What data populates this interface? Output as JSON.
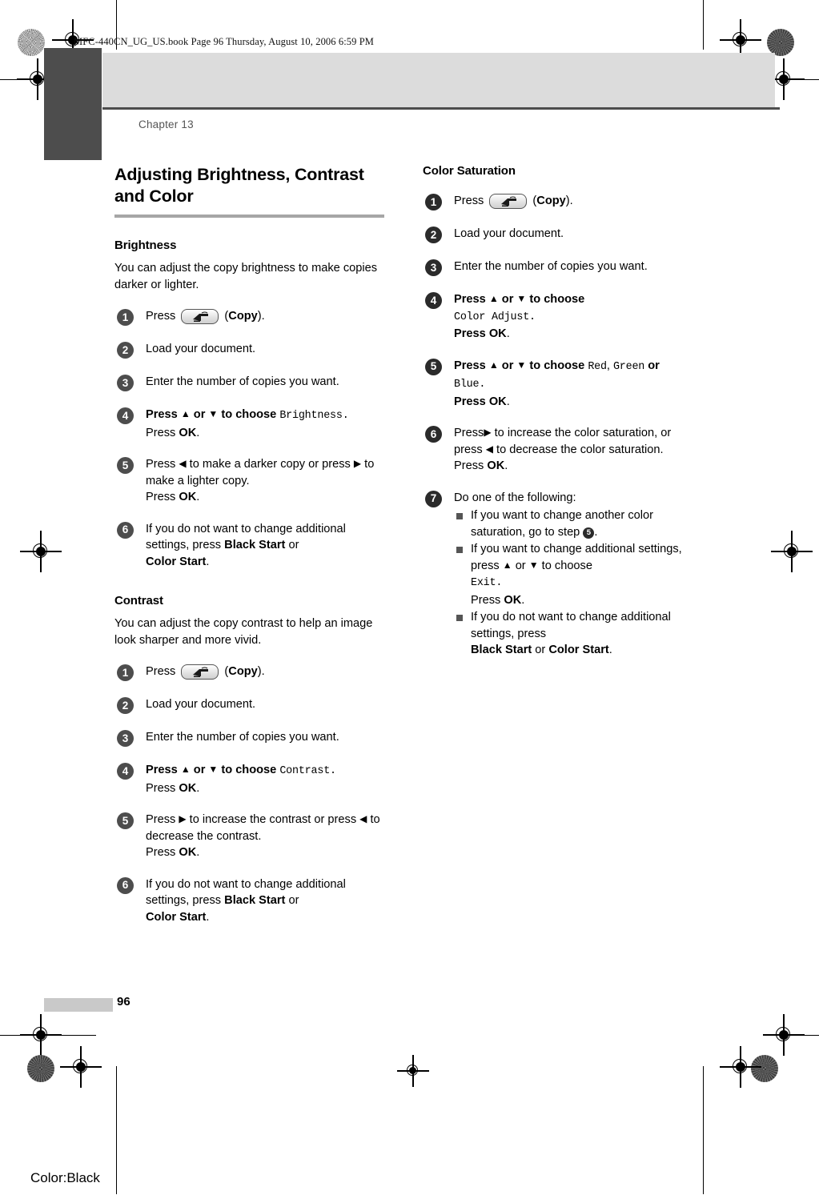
{
  "proof": {
    "header_text": "MFC-440CN_UG_US.book  Page 96  Thursday, August 10, 2006  6:59 PM",
    "color_plate": "Color:Black",
    "page_number": "96"
  },
  "running_head": "Chapter 13",
  "title": "Adjusting Brightness, Contrast and Color",
  "left_column": {
    "sections": [
      {
        "heading": "Brightness",
        "intro": "You can adjust the copy brightness to make copies darker or lighter.",
        "steps": [
          {
            "num": "1",
            "parts": [
              {
                "t": "text",
                "v": "Press "
              },
              {
                "t": "key",
                "v": "copy-key"
              },
              {
                "t": "text",
                "v": " ("
              },
              {
                "t": "bold",
                "v": "Copy"
              },
              {
                "t": "text",
                "v": ")."
              }
            ]
          },
          {
            "num": "2",
            "parts": [
              {
                "t": "text",
                "v": "Load your document."
              }
            ]
          },
          {
            "num": "3",
            "parts": [
              {
                "t": "text",
                "v": "Enter the number of copies you want."
              }
            ]
          },
          {
            "num": "4",
            "parts": [
              {
                "t": "bold",
                "v": "Press "
              },
              {
                "t": "glyph",
                "v": "▲"
              },
              {
                "t": "bold",
                "v": " or "
              },
              {
                "t": "glyph",
                "v": "▼"
              },
              {
                "t": "bold",
                "v": " to choose "
              },
              {
                "t": "mono",
                "v": "Brightness."
              },
              {
                "t": "br"
              },
              {
                "t": "text",
                "v": "Press "
              },
              {
                "t": "bold",
                "v": "OK"
              },
              {
                "t": "text",
                "v": "."
              }
            ]
          },
          {
            "num": "5",
            "parts": [
              {
                "t": "text",
                "v": "Press "
              },
              {
                "t": "glyph",
                "v": "◀"
              },
              {
                "t": "text",
                "v": " to make a darker copy or press "
              },
              {
                "t": "glyph",
                "v": "▶"
              },
              {
                "t": "text",
                "v": " to make a lighter copy."
              },
              {
                "t": "br"
              },
              {
                "t": "text",
                "v": "Press "
              },
              {
                "t": "bold",
                "v": "OK"
              },
              {
                "t": "text",
                "v": "."
              }
            ]
          },
          {
            "num": "6",
            "parts": [
              {
                "t": "text",
                "v": "If you do not want to change additional settings, press "
              },
              {
                "t": "bold",
                "v": "Black Start"
              },
              {
                "t": "text",
                "v": " or "
              },
              {
                "t": "br"
              },
              {
                "t": "bold",
                "v": "Color Start"
              },
              {
                "t": "text",
                "v": "."
              }
            ]
          }
        ]
      },
      {
        "heading": "Contrast",
        "intro": "You can adjust the copy contrast to help an image look sharper and more vivid.",
        "steps": [
          {
            "num": "1",
            "parts": [
              {
                "t": "text",
                "v": "Press "
              },
              {
                "t": "key",
                "v": "copy-key"
              },
              {
                "t": "text",
                "v": " ("
              },
              {
                "t": "bold",
                "v": "Copy"
              },
              {
                "t": "text",
                "v": ")."
              }
            ]
          },
          {
            "num": "2",
            "parts": [
              {
                "t": "text",
                "v": "Load your document."
              }
            ]
          },
          {
            "num": "3",
            "parts": [
              {
                "t": "text",
                "v": "Enter the number of copies you want."
              }
            ]
          },
          {
            "num": "4",
            "parts": [
              {
                "t": "bold",
                "v": "Press "
              },
              {
                "t": "glyph",
                "v": "▲"
              },
              {
                "t": "bold",
                "v": " or "
              },
              {
                "t": "glyph",
                "v": "▼"
              },
              {
                "t": "bold",
                "v": " to choose "
              },
              {
                "t": "mono",
                "v": "Contrast."
              },
              {
                "t": "br"
              },
              {
                "t": "text",
                "v": "Press "
              },
              {
                "t": "bold",
                "v": "OK"
              },
              {
                "t": "text",
                "v": "."
              }
            ]
          },
          {
            "num": "5",
            "parts": [
              {
                "t": "text",
                "v": "Press "
              },
              {
                "t": "glyph",
                "v": "▶"
              },
              {
                "t": "text",
                "v": " to increase the contrast or press "
              },
              {
                "t": "glyph",
                "v": "◀"
              },
              {
                "t": "text",
                "v": " to decrease the contrast."
              },
              {
                "t": "br"
              },
              {
                "t": "text",
                "v": "Press "
              },
              {
                "t": "bold",
                "v": "OK"
              },
              {
                "t": "text",
                "v": "."
              }
            ]
          },
          {
            "num": "6",
            "parts": [
              {
                "t": "text",
                "v": "If you do not want to change additional settings, press "
              },
              {
                "t": "bold",
                "v": "Black Start"
              },
              {
                "t": "text",
                "v": " or "
              },
              {
                "t": "br"
              },
              {
                "t": "bold",
                "v": "Color Start"
              },
              {
                "t": "text",
                "v": "."
              }
            ]
          }
        ]
      }
    ]
  },
  "right_column": {
    "sections": [
      {
        "heading": "Color Saturation",
        "intro": "",
        "steps": [
          {
            "num": "1",
            "parts": [
              {
                "t": "text",
                "v": "Press "
              },
              {
                "t": "key",
                "v": "copy-key"
              },
              {
                "t": "text",
                "v": " ("
              },
              {
                "t": "bold",
                "v": "Copy"
              },
              {
                "t": "text",
                "v": ")."
              }
            ]
          },
          {
            "num": "2",
            "parts": [
              {
                "t": "text",
                "v": "Load your document."
              }
            ]
          },
          {
            "num": "3",
            "parts": [
              {
                "t": "text",
                "v": "Enter the number of copies you want."
              }
            ]
          },
          {
            "num": "4",
            "parts": [
              {
                "t": "bold",
                "v": "Press "
              },
              {
                "t": "glyph",
                "v": "▲"
              },
              {
                "t": "bold",
                "v": " or "
              },
              {
                "t": "glyph",
                "v": "▼"
              },
              {
                "t": "bold",
                "v": " to choose"
              },
              {
                "t": "br"
              },
              {
                "t": "mono",
                "v": "Color Adjust."
              },
              {
                "t": "br"
              },
              {
                "t": "bold",
                "v": "Press OK"
              },
              {
                "t": "text",
                "v": "."
              }
            ]
          },
          {
            "num": "5",
            "parts": [
              {
                "t": "bold",
                "v": "Press "
              },
              {
                "t": "glyph",
                "v": "▲"
              },
              {
                "t": "bold",
                "v": " or "
              },
              {
                "t": "glyph",
                "v": "▼"
              },
              {
                "t": "bold",
                "v": " to choose "
              },
              {
                "t": "mono",
                "v": "Red"
              },
              {
                "t": "text",
                "v": ", "
              },
              {
                "t": "mono",
                "v": "Green"
              },
              {
                "t": "bold",
                "v": " or "
              },
              {
                "t": "br"
              },
              {
                "t": "mono",
                "v": "Blue."
              },
              {
                "t": "br"
              },
              {
                "t": "bold",
                "v": "Press OK"
              },
              {
                "t": "text",
                "v": "."
              }
            ]
          },
          {
            "num": "6",
            "parts": [
              {
                "t": "text",
                "v": "Press"
              },
              {
                "t": "glyph",
                "v": "▶"
              },
              {
                "t": "text",
                "v": " to increase the color saturation, or press "
              },
              {
                "t": "glyph",
                "v": "◀"
              },
              {
                "t": "text",
                "v": " to decrease the color saturation."
              },
              {
                "t": "br"
              },
              {
                "t": "text",
                "v": "Press "
              },
              {
                "t": "bold",
                "v": "OK"
              },
              {
                "t": "text",
                "v": "."
              }
            ]
          },
          {
            "num": "7",
            "parts": [
              {
                "t": "text",
                "v": "Do one of the following:"
              }
            ],
            "sub": [
              {
                "parts": [
                  {
                    "t": "text",
                    "v": "If you want to change another color saturation, go to step "
                  },
                  {
                    "t": "ref",
                    "v": "5"
                  },
                  {
                    "t": "text",
                    "v": "."
                  }
                ]
              },
              {
                "parts": [
                  {
                    "t": "text",
                    "v": "If you want to change additional settings, press "
                  },
                  {
                    "t": "glyph",
                    "v": "▲"
                  },
                  {
                    "t": "text",
                    "v": " or "
                  },
                  {
                    "t": "glyph",
                    "v": "▼"
                  },
                  {
                    "t": "text",
                    "v": " to choose "
                  },
                  {
                    "t": "br"
                  },
                  {
                    "t": "mono",
                    "v": "Exit."
                  },
                  {
                    "t": "br"
                  },
                  {
                    "t": "text",
                    "v": "Press "
                  },
                  {
                    "t": "bold",
                    "v": "OK"
                  },
                  {
                    "t": "text",
                    "v": "."
                  }
                ]
              },
              {
                "parts": [
                  {
                    "t": "text",
                    "v": "If you do not want to change additional settings, press "
                  },
                  {
                    "t": "br"
                  },
                  {
                    "t": "bold",
                    "v": "Black Start"
                  },
                  {
                    "t": "text",
                    "v": " or "
                  },
                  {
                    "t": "bold",
                    "v": "Color Start"
                  },
                  {
                    "t": "text",
                    "v": "."
                  }
                ]
              }
            ]
          }
        ]
      }
    ]
  },
  "colors": {
    "header_band": "#dcdcdc",
    "side_tab": "#4d4d4d",
    "title_rule": "#a6a6a6",
    "bullet": "#4d4d4d",
    "bullet_dark": "#2b2b2b",
    "footer_bar": "#c9c9c9"
  }
}
